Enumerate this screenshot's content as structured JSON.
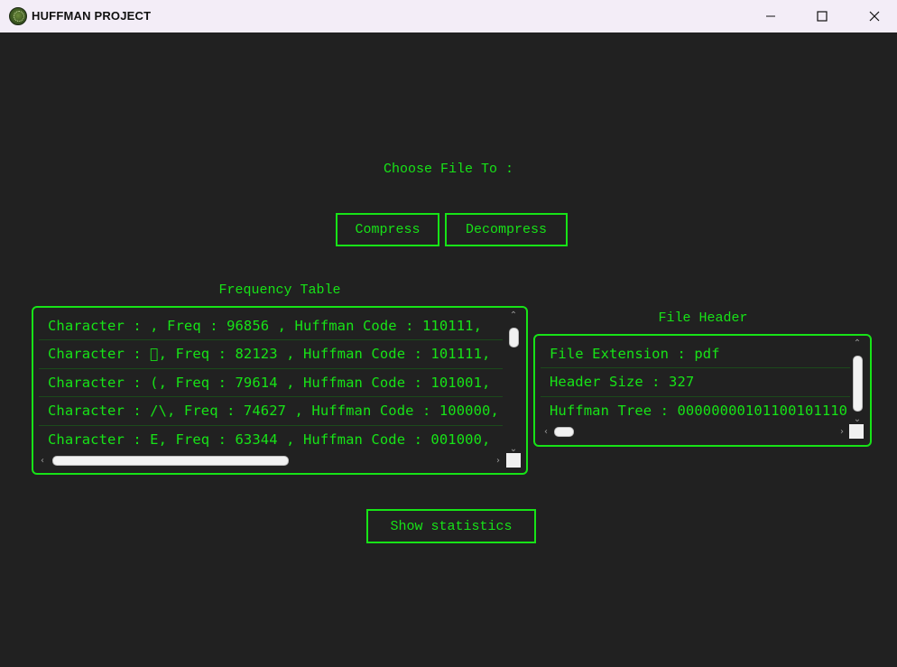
{
  "window": {
    "title": "HUFFMAN PROJECT",
    "controls": [
      "minimize-icon",
      "maximize-icon",
      "close-icon"
    ]
  },
  "main": {
    "choose_label": "Choose File To :",
    "compress_label": "Compress",
    "decompress_label": "Decompress",
    "stats_label": "Show statistics"
  },
  "frequency_table": {
    "label": "Frequency Table",
    "rows": [
      "Character :  , Freq : 96856 , Huffman Code : 110111,",
      "Character : \u0000, Freq : 82123 , Huffman Code : 101111,",
      "Character : (, Freq : 79614 , Huffman Code : 101001,",
      "Character : /\\, Freq : 74627 , Huffman Code : 100000,",
      "Character : E, Freq : 63344 , Huffman Code : 001000,"
    ]
  },
  "file_header": {
    "label": "File Header",
    "rows": [
      "File Extension : pdf",
      "Header Size : 327",
      "Huffman Tree : 00000000101100101110"
    ]
  },
  "colors": {
    "background": "#212121",
    "accent": "#17e317",
    "titlebar": "#f3edf7"
  }
}
